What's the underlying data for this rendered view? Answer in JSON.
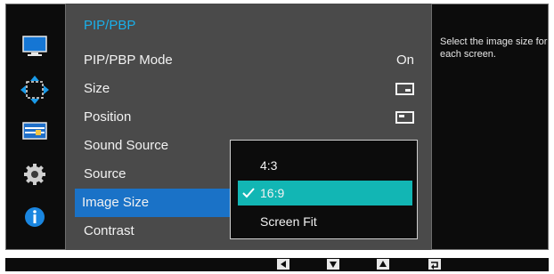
{
  "menu": {
    "title": "PIP/PBP",
    "items": [
      {
        "label": "PIP/PBP Mode",
        "value": "On"
      },
      {
        "label": "Size",
        "value": ""
      },
      {
        "label": "Position",
        "value": ""
      },
      {
        "label": "Sound Source",
        "value": ""
      },
      {
        "label": "Source",
        "value": ""
      },
      {
        "label": "Image Size",
        "value": ""
      },
      {
        "label": "Contrast",
        "value": ""
      }
    ],
    "selected_index": 5
  },
  "sidebar": {
    "icons": [
      "picture-icon",
      "onscreen-display-icon",
      "pip-pbp-icon",
      "settings-gear-icon",
      "information-icon"
    ]
  },
  "dropdown": {
    "options": [
      "4:3",
      "16:9",
      "Screen Fit"
    ],
    "selected_index": 1
  },
  "help_text": "Select the image size for each screen.",
  "nav_icons": [
    "left-arrow-icon",
    "down-arrow-icon",
    "up-arrow-icon",
    "return-icon"
  ],
  "colors": {
    "accent_blue": "#1a72c7",
    "title_cyan": "#1ab0ea",
    "selected_teal": "#12b6b4"
  }
}
